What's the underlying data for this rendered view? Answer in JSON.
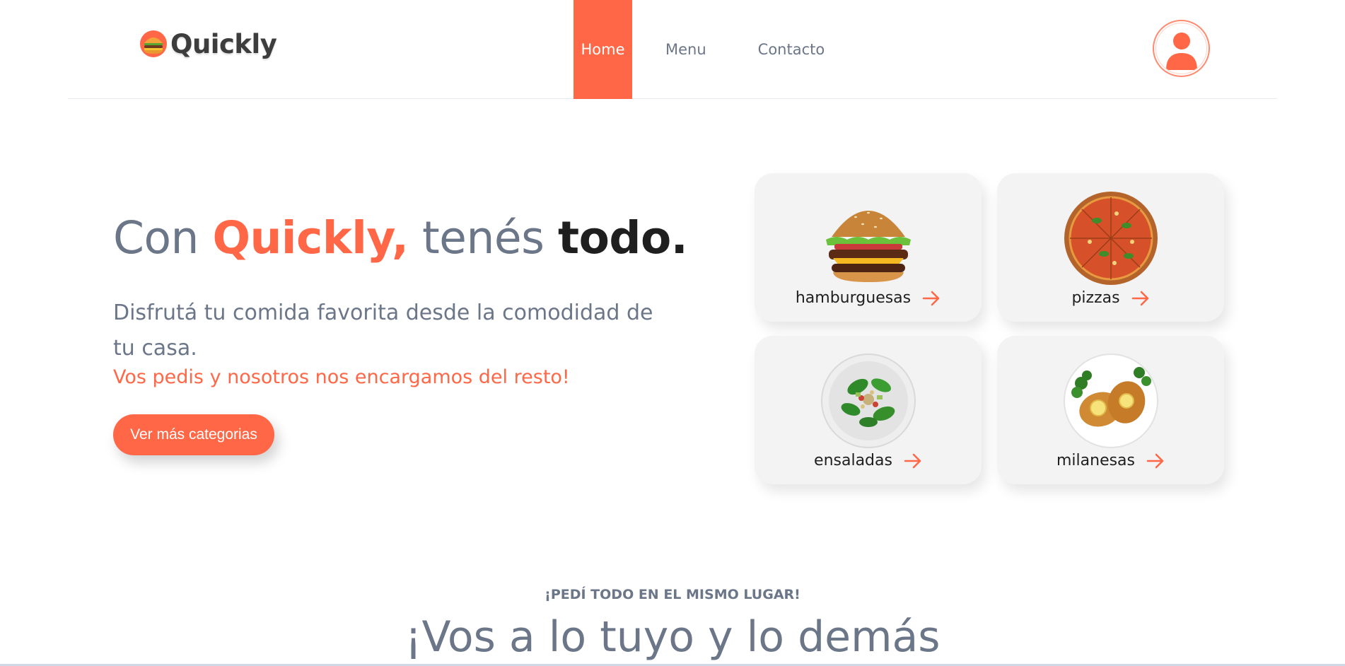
{
  "header": {
    "logo_text": "Quickly",
    "logo_icon": "burger-logo-icon",
    "nav": [
      {
        "label": "Home",
        "active": true
      },
      {
        "label": "Menu",
        "active": false
      },
      {
        "label": "Contacto",
        "active": false
      }
    ],
    "profile_icon": "user-icon"
  },
  "hero": {
    "title_part1": "Con ",
    "title_brand": "Quickly,",
    "title_part2": " tenés ",
    "title_bold": "todo.",
    "description": "Disfrutá tu comida favorita desde la comodidad de tu casa.",
    "subtext": "Vos pedis y nosotros nos encargamos del resto!",
    "cta_label": "Ver más categorias"
  },
  "categories": [
    {
      "label": "hamburguesas",
      "icon": "burger-image"
    },
    {
      "label": "pizzas",
      "icon": "pizza-image"
    },
    {
      "label": "ensaladas",
      "icon": "salad-image"
    },
    {
      "label": "milanesas",
      "icon": "milanesa-image"
    }
  ],
  "section": {
    "kicker": "¡PEDÍ TODO EN EL MISMO LUGAR!",
    "title": "¡Vos a lo tuyo y lo demás"
  },
  "colors": {
    "accent": "#ff6747",
    "text_muted": "#6b7689",
    "text_dark": "#1f1f1f",
    "card_bg": "#f3f3f3"
  }
}
